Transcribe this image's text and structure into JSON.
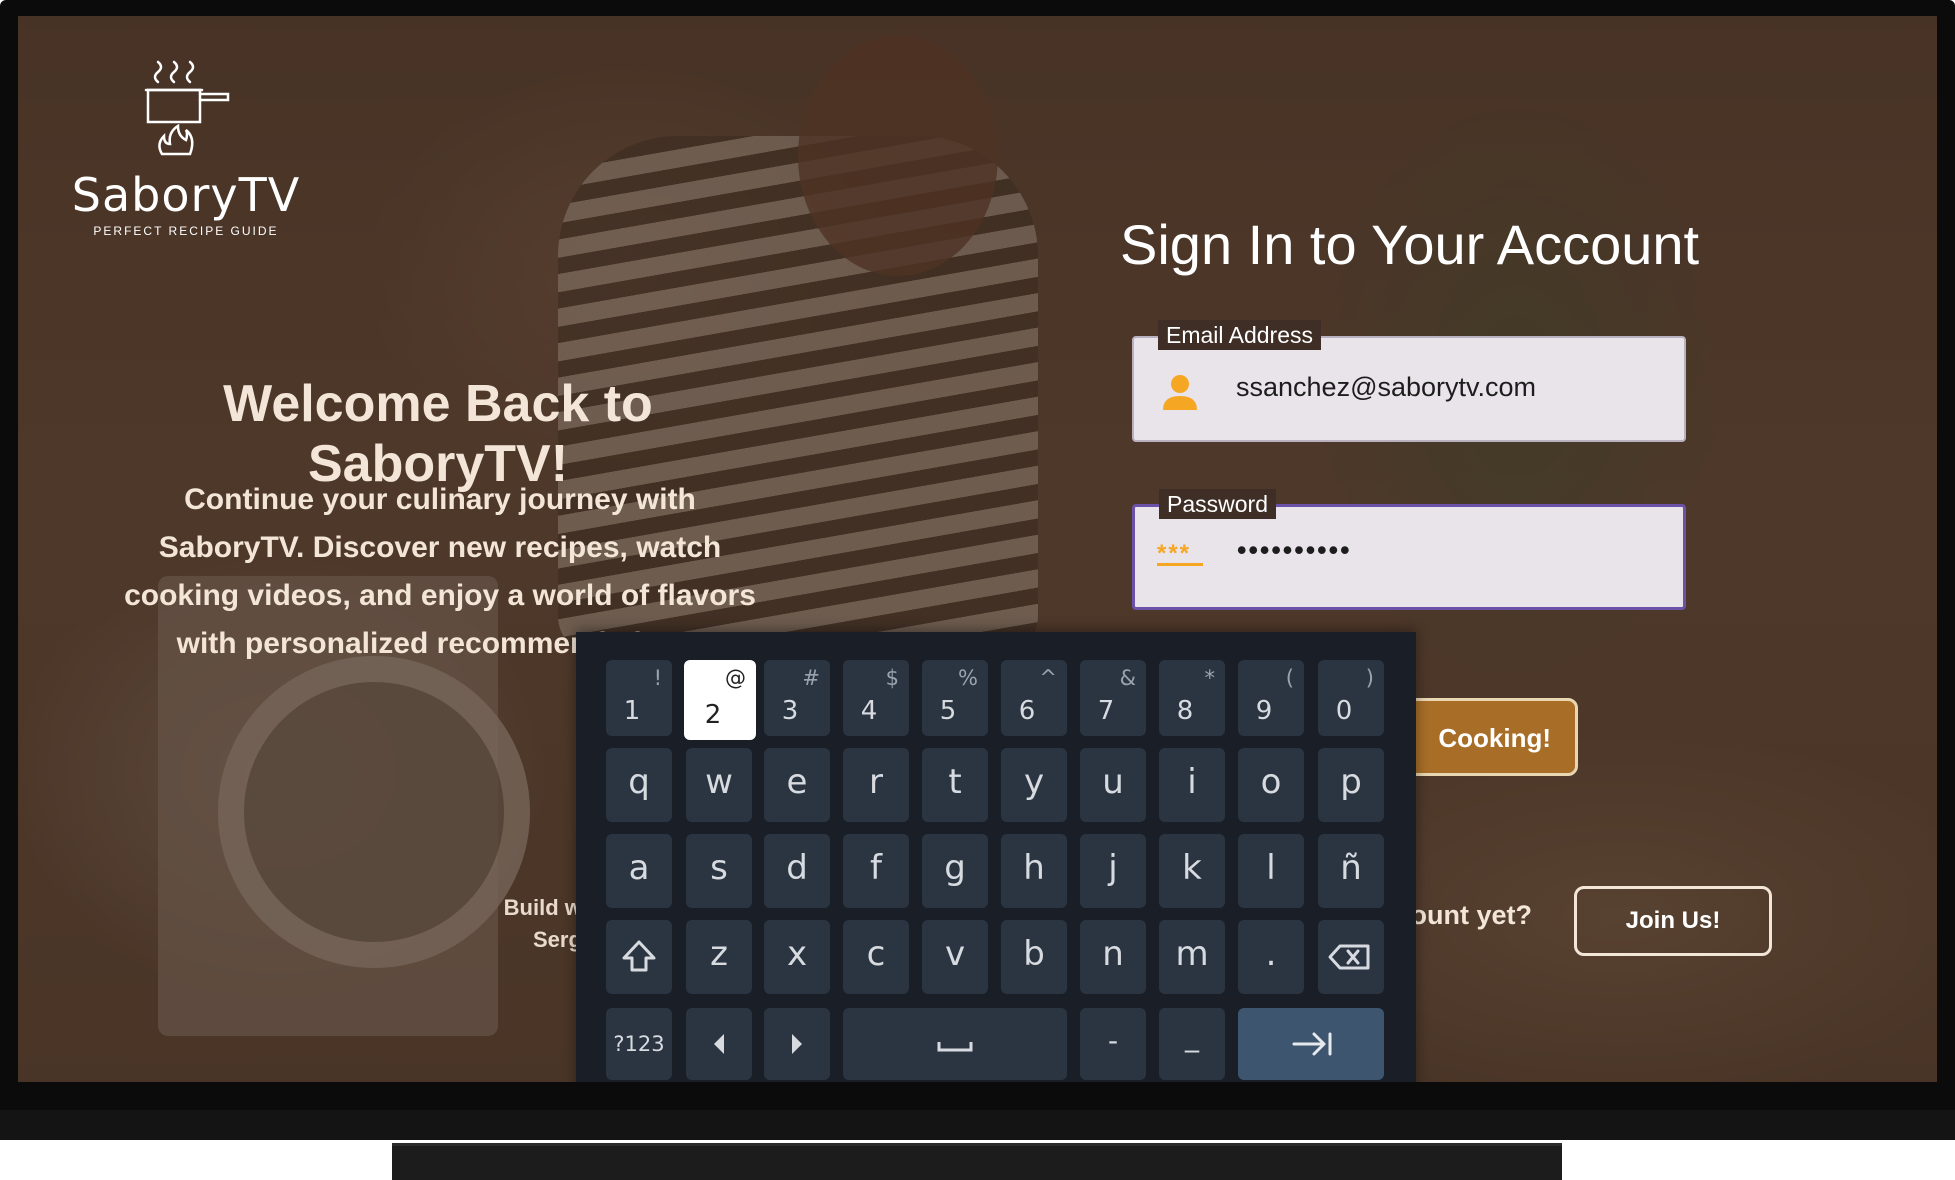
{
  "brand": {
    "name": "SaboryTV",
    "tagline": "PERFECT RECIPE GUIDE"
  },
  "welcome": {
    "title": "Welcome Back to SaboryTV!",
    "description": "Continue your culinary journey with SaboryTV. Discover new recipes, watch cooking videos, and enjoy a world of flavors with personalized recommendations.",
    "credit_line1": "Build wi",
    "credit_line2": "Sergi"
  },
  "signin": {
    "title": "Sign In to Your Account",
    "email_label": "Email Address",
    "email_value": "ssanchez@saborytv.com",
    "password_label": "Password",
    "password_value": "••••••••••",
    "password_icon_text": "***",
    "submit_label": "Cooking!",
    "account_prompt": "ount yet?",
    "join_label": "Join Us!"
  },
  "keyboard": {
    "number_row": [
      {
        "main": "1",
        "alt": "!"
      },
      {
        "main": "2",
        "alt": "@"
      },
      {
        "main": "3",
        "alt": "#"
      },
      {
        "main": "4",
        "alt": "$"
      },
      {
        "main": "5",
        "alt": "%"
      },
      {
        "main": "6",
        "alt": "^"
      },
      {
        "main": "7",
        "alt": "&"
      },
      {
        "main": "8",
        "alt": "*"
      },
      {
        "main": "9",
        "alt": "("
      },
      {
        "main": "0",
        "alt": ")"
      }
    ],
    "row1": [
      "q",
      "w",
      "e",
      "r",
      "t",
      "y",
      "u",
      "i",
      "o",
      "p"
    ],
    "row2": [
      "a",
      "s",
      "d",
      "f",
      "g",
      "h",
      "j",
      "k",
      "l",
      "ñ"
    ],
    "row3": [
      "z",
      "x",
      "c",
      "v",
      "b",
      "n",
      "m",
      "."
    ],
    "symbols_label": "?123",
    "dash": "-",
    "underscore": "_",
    "focused_key": "2"
  },
  "colors": {
    "accent_purple": "#6b51a8",
    "button_gold": "#a86e28",
    "icon_orange": "#f5a623"
  }
}
